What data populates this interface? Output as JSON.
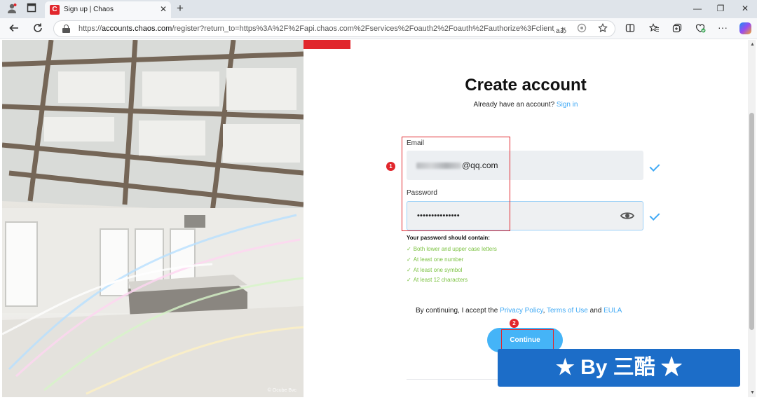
{
  "browser": {
    "tab_title": "Sign up | Chaos",
    "tab_favicon": "C",
    "tab_close": "✕",
    "new_tab": "+",
    "url_prefix": "https://",
    "url_host": "accounts.chaos.com",
    "url_rest": "/register?return_to=https%3A%2F%2Fapi.chaos.com%2Fservices%2Foauth2%2Foauth%2Fauthorize%3Fclient_id%3...",
    "translate_icon": "aあ",
    "window_min": "—",
    "window_max": "❐",
    "window_close": "✕"
  },
  "page": {
    "title": "Create account",
    "have_account_text": "Already have an account?",
    "sign_in_link": "Sign in",
    "email_label": "Email",
    "email_value_visible": "@qq.com",
    "password_label": "Password",
    "password_value": "•••••••••••••••",
    "requirements_title": "Your password should contain:",
    "requirements": [
      "Both lower and upper case letters",
      "At least one number",
      "At least one symbol",
      "At least 12 characters"
    ],
    "terms_prefix": "By continuing, I accept the",
    "privacy_policy": "Privacy Policy",
    "terms_of_use": "Terms of Use",
    "and_text": "and",
    "eula": "EULA",
    "continue_button": "Continue",
    "photo_credit": "© Ocube Bvc"
  },
  "annotations": {
    "badge_1": "1",
    "badge_2": "2",
    "annotation_color": "#e1262c"
  },
  "watermark": {
    "text": "★ By 三酷 ★"
  },
  "colors": {
    "accent": "#3fa9f5",
    "button": "#45b4f7",
    "brand_red": "#e1262c",
    "requirement_ok": "#7cc242"
  },
  "icons": {
    "profile": "profile-icon",
    "tab_actions": "tab-actions-icon",
    "back": "back-arrow-icon",
    "refresh": "refresh-icon",
    "lock": "lock-icon",
    "favorite": "star-icon",
    "split_screen": "split-screen-icon",
    "favorites": "favorites-icon",
    "collections": "collections-icon",
    "browser_essentials": "heart-icon",
    "more": "more-icon",
    "copilot": "copilot-icon",
    "password_visibility": "eye-icon",
    "field_valid": "checkmark-icon"
  }
}
